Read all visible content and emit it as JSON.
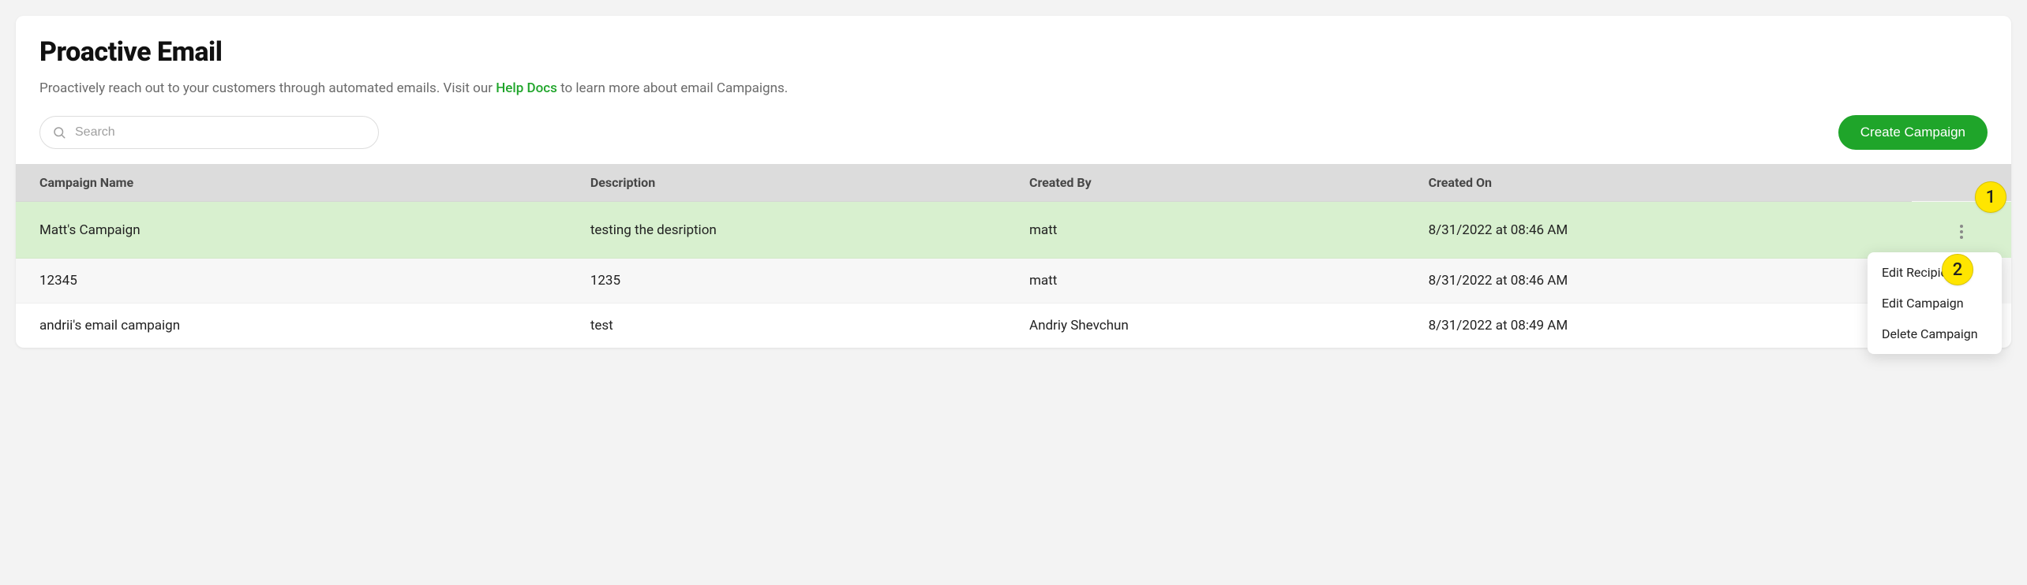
{
  "header": {
    "title": "Proactive Email",
    "subtitle_pre": "Proactively reach out to your customers through automated emails. Visit our ",
    "subtitle_link": "Help Docs",
    "subtitle_post": " to learn more about email Campaigns."
  },
  "search": {
    "placeholder": "Search",
    "value": ""
  },
  "buttons": {
    "create": "Create Campaign"
  },
  "table": {
    "columns": {
      "name": "Campaign Name",
      "desc": "Description",
      "by": "Created By",
      "on": "Created On"
    },
    "rows": [
      {
        "name": "Matt's Campaign",
        "desc": "testing the desription",
        "by": "matt",
        "on": "8/31/2022 at 08:46 AM",
        "highlight": true
      },
      {
        "name": "12345",
        "desc": "1235",
        "by": "matt",
        "on": "8/31/2022 at 08:46 AM",
        "highlight": false
      },
      {
        "name": "andrii's email campaign",
        "desc": "test",
        "by": "Andriy Shevchun",
        "on": "8/31/2022 at 08:49 AM",
        "highlight": false
      }
    ]
  },
  "menu": {
    "items": [
      "Edit Recipients",
      "Edit Campaign",
      "Delete Campaign"
    ]
  },
  "annotations": {
    "a1": "1",
    "a2": "2"
  }
}
